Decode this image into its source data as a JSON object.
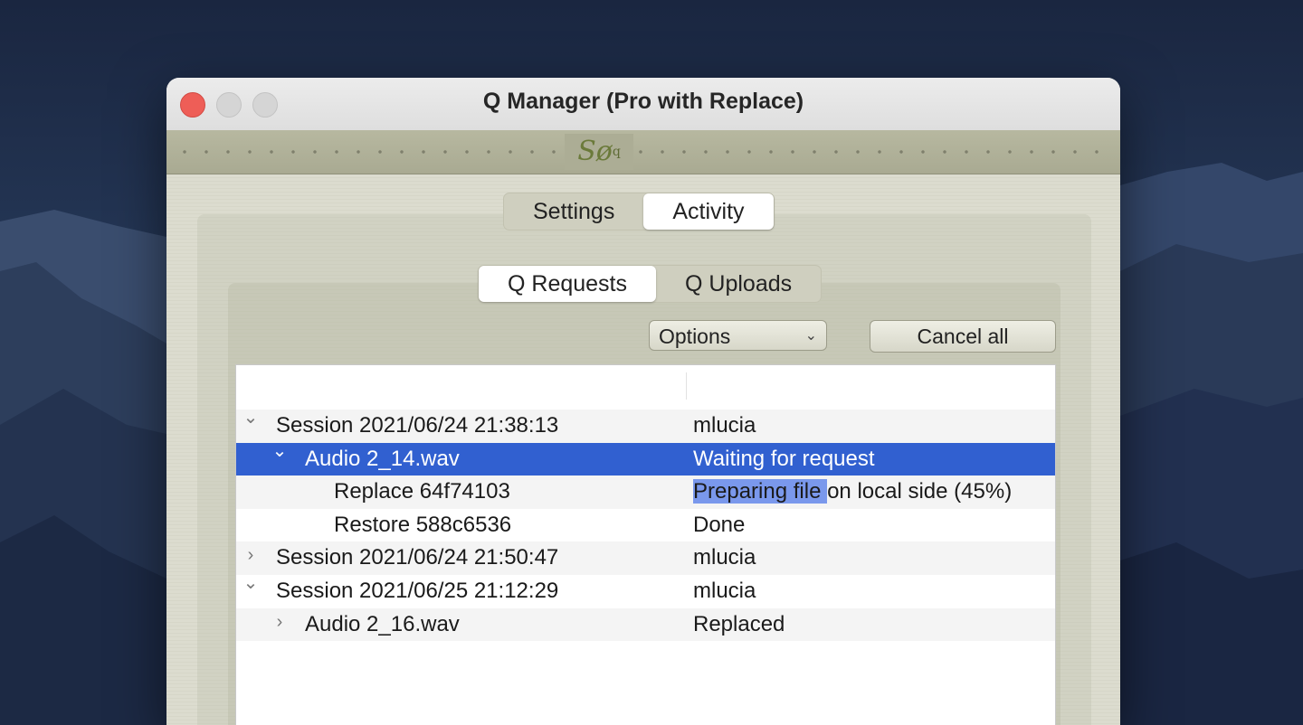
{
  "window": {
    "title": "Q Manager (Pro with Replace)",
    "logo_text": "Sø",
    "logo_sup": "q"
  },
  "main_tabs": [
    {
      "label": "Settings",
      "selected": false
    },
    {
      "label": "Activity",
      "selected": true
    }
  ],
  "sub_tabs": [
    {
      "label": "Q Requests",
      "selected": true
    },
    {
      "label": "Q Uploads",
      "selected": false
    }
  ],
  "toolbar": {
    "options_label": "Options",
    "cancel_all_label": "Cancel all"
  },
  "progress": {
    "preparing_fraction": 0.45
  },
  "rows": [
    {
      "name": "Session 2021/06/24 21:38:13",
      "status": "mlucia",
      "level": 0,
      "expanded": true,
      "selected": false
    },
    {
      "name": "Audio 2_14.wav",
      "status": "Waiting for request",
      "level": 1,
      "expanded": true,
      "selected": true
    },
    {
      "name": "Replace 64f74103",
      "status": "Preparing file on local side (45%)",
      "level": 2,
      "expanded": null,
      "selected": false
    },
    {
      "name": "Restore 588c6536",
      "status": "Done",
      "level": 2,
      "expanded": null,
      "selected": false
    },
    {
      "name": "Session 2021/06/24 21:50:47",
      "status": "mlucia",
      "level": 0,
      "expanded": false,
      "selected": false
    },
    {
      "name": "Session 2021/06/25 21:12:29",
      "status": "mlucia",
      "level": 0,
      "expanded": true,
      "selected": false
    },
    {
      "name": "Audio 2_16.wav",
      "status": "Replaced",
      "level": 1,
      "expanded": false,
      "selected": false
    }
  ]
}
